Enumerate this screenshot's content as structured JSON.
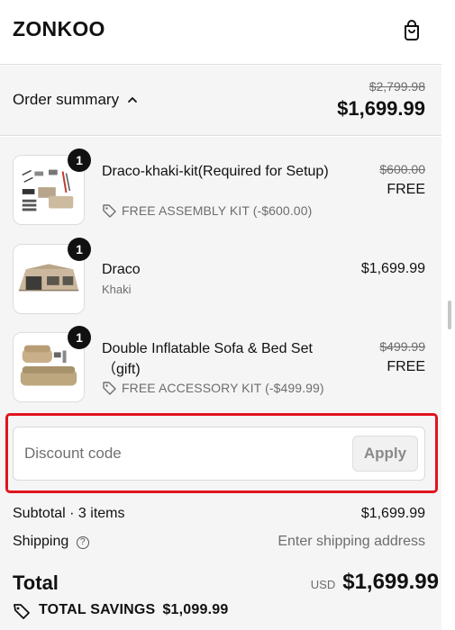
{
  "header": {
    "brand": "ZONKOO",
    "cart_icon": "shopping-bag-icon"
  },
  "summary": {
    "toggle_label": "Order summary",
    "toggle_icon": "chevron-up-icon",
    "original_total": "$2,799.98",
    "total": "$1,699.99"
  },
  "items": [
    {
      "quantity": "1",
      "title": "Draco-khaki-kit(Required for Setup)",
      "subtitle": "",
      "discount": "FREE ASSEMBLY KIT (-$600.00)",
      "original_price": "$600.00",
      "price": "FREE",
      "image_icon": "assembly-kit-image"
    },
    {
      "quantity": "1",
      "title": "Draco",
      "subtitle": "Khaki",
      "discount": "",
      "original_price": "",
      "price": "$1,699.99",
      "image_icon": "tent-image"
    },
    {
      "quantity": "1",
      "title": "Double Inflatable Sofa & Bed Set （gift)",
      "subtitle": "",
      "discount": "FREE ACCESSORY KIT (-$499.99)",
      "original_price": "$499.99",
      "price": "FREE",
      "image_icon": "inflatable-sofa-image"
    }
  ],
  "discount": {
    "placeholder": "Discount code",
    "value": "",
    "apply_label": "Apply"
  },
  "totals": {
    "subtotal_label": "Subtotal · 3 items",
    "subtotal_value": "$1,699.99",
    "shipping_label": "Shipping",
    "shipping_help_icon": "question-circle-icon",
    "shipping_value": "Enter shipping address",
    "total_label": "Total",
    "currency": "USD",
    "total_value": "$1,699.99",
    "savings_label": "TOTAL SAVINGS",
    "savings_value": "$1,099.99"
  },
  "colors": {
    "highlight": "#e0141e",
    "panel_bg": "#f5f5f5",
    "badge": "#111111"
  }
}
